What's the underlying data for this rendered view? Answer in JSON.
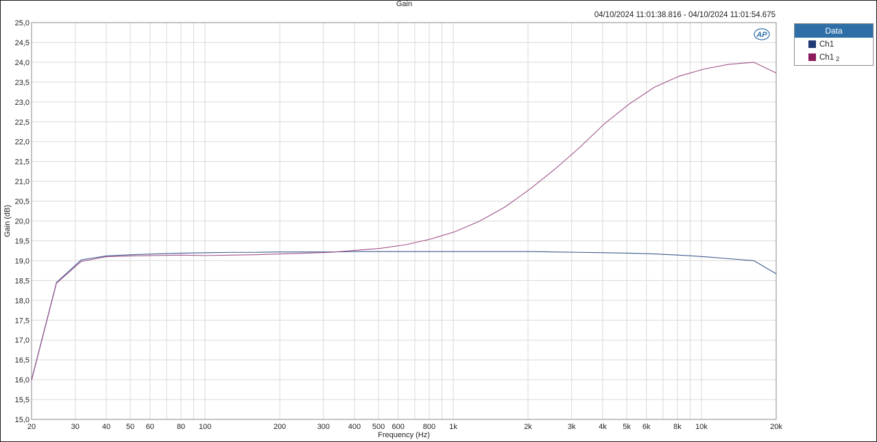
{
  "header": {
    "title": "Gain",
    "timestamp": "04/10/2024 11:01:38.816 - 04/10/2024 11:01:54.675"
  },
  "legend": {
    "title": "Data",
    "items": [
      {
        "label": "Ch1",
        "sub": "",
        "color": "#1f3a73"
      },
      {
        "label": "Ch1",
        "sub": "2",
        "color": "#8c1a5c"
      }
    ]
  },
  "logo": {
    "text": "AP"
  },
  "chart_data": {
    "type": "line",
    "xlabel": "Frequency (Hz)",
    "ylabel": "Gain (dB)",
    "xscale": "log",
    "xlim": [
      20,
      20000
    ],
    "ylim": [
      15.0,
      25.0
    ],
    "grid": true,
    "legend_position": "right",
    "x_ticks": [
      {
        "value": 20,
        "label": "20"
      },
      {
        "value": 30,
        "label": "30"
      },
      {
        "value": 40,
        "label": "40"
      },
      {
        "value": 50,
        "label": "50"
      },
      {
        "value": 60,
        "label": "60"
      },
      {
        "value": 80,
        "label": "80"
      },
      {
        "value": 100,
        "label": "100"
      },
      {
        "value": 200,
        "label": "200"
      },
      {
        "value": 300,
        "label": "300"
      },
      {
        "value": 400,
        "label": "400"
      },
      {
        "value": 500,
        "label": "500"
      },
      {
        "value": 600,
        "label": "600"
      },
      {
        "value": 800,
        "label": "800"
      },
      {
        "value": 1000,
        "label": "1k"
      },
      {
        "value": 2000,
        "label": "2k"
      },
      {
        "value": 3000,
        "label": "3k"
      },
      {
        "value": 4000,
        "label": "4k"
      },
      {
        "value": 5000,
        "label": "5k"
      },
      {
        "value": 6000,
        "label": "6k"
      },
      {
        "value": 8000,
        "label": "8k"
      },
      {
        "value": 10000,
        "label": "10k"
      },
      {
        "value": 20000,
        "label": "20k"
      }
    ],
    "y_ticks": [
      {
        "value": 15.0,
        "label": "15,0"
      },
      {
        "value": 15.5,
        "label": "15,5"
      },
      {
        "value": 16.0,
        "label": "16,0"
      },
      {
        "value": 16.5,
        "label": "16,5"
      },
      {
        "value": 17.0,
        "label": "17,0"
      },
      {
        "value": 17.5,
        "label": "17,5"
      },
      {
        "value": 18.0,
        "label": "18,0"
      },
      {
        "value": 18.5,
        "label": "18,5"
      },
      {
        "value": 19.0,
        "label": "19,0"
      },
      {
        "value": 19.5,
        "label": "19,5"
      },
      {
        "value": 20.0,
        "label": "20,0"
      },
      {
        "value": 20.5,
        "label": "20,5"
      },
      {
        "value": 21.0,
        "label": "21,0"
      },
      {
        "value": 21.5,
        "label": "21,5"
      },
      {
        "value": 22.0,
        "label": "22,0"
      },
      {
        "value": 22.5,
        "label": "22,5"
      },
      {
        "value": 23.0,
        "label": "23,0"
      },
      {
        "value": 23.5,
        "label": "23,5"
      },
      {
        "value": 24.0,
        "label": "24,0"
      },
      {
        "value": 24.5,
        "label": "24,5"
      },
      {
        "value": 25.0,
        "label": "25,0"
      }
    ],
    "series": [
      {
        "name": "Ch1",
        "color": "#3d5a8c",
        "points": [
          [
            20,
            16.0
          ],
          [
            25.2,
            18.45
          ],
          [
            31.7,
            19.02
          ],
          [
            40,
            19.12
          ],
          [
            50.4,
            19.15
          ],
          [
            63.5,
            19.17
          ],
          [
            80,
            19.19
          ],
          [
            100.8,
            19.2
          ],
          [
            127,
            19.21
          ],
          [
            160,
            19.21
          ],
          [
            201.6,
            19.22
          ],
          [
            254,
            19.22
          ],
          [
            320,
            19.22
          ],
          [
            403,
            19.23
          ],
          [
            508,
            19.23
          ],
          [
            640,
            19.23
          ],
          [
            806,
            19.23
          ],
          [
            1016,
            19.23
          ],
          [
            1280,
            19.23
          ],
          [
            1613,
            19.23
          ],
          [
            2032,
            19.23
          ],
          [
            2560,
            19.22
          ],
          [
            3225,
            19.21
          ],
          [
            4064,
            19.2
          ],
          [
            5120,
            19.19
          ],
          [
            6451,
            19.17
          ],
          [
            8128,
            19.14
          ],
          [
            10240,
            19.1
          ],
          [
            12902,
            19.05
          ],
          [
            16256,
            19.0
          ],
          [
            20000,
            18.67
          ]
        ]
      },
      {
        "name": "Ch1 2",
        "color": "#a0508a",
        "points": [
          [
            20,
            15.98
          ],
          [
            25.2,
            18.43
          ],
          [
            31.7,
            18.98
          ],
          [
            40,
            19.1
          ],
          [
            50.4,
            19.12
          ],
          [
            63.5,
            19.13
          ],
          [
            80,
            19.14
          ],
          [
            100.8,
            19.13
          ],
          [
            127,
            19.14
          ],
          [
            160,
            19.15
          ],
          [
            201.6,
            19.17
          ],
          [
            254,
            19.19
          ],
          [
            320,
            19.21
          ],
          [
            403,
            19.26
          ],
          [
            508,
            19.31
          ],
          [
            640,
            19.4
          ],
          [
            806,
            19.54
          ],
          [
            1016,
            19.73
          ],
          [
            1280,
            20.0
          ],
          [
            1613,
            20.35
          ],
          [
            2032,
            20.8
          ],
          [
            2560,
            21.3
          ],
          [
            3225,
            21.85
          ],
          [
            4064,
            22.45
          ],
          [
            5120,
            22.95
          ],
          [
            6451,
            23.37
          ],
          [
            8128,
            23.65
          ],
          [
            10240,
            23.83
          ],
          [
            12902,
            23.95
          ],
          [
            16256,
            24.0
          ],
          [
            20000,
            23.73
          ]
        ]
      }
    ]
  }
}
